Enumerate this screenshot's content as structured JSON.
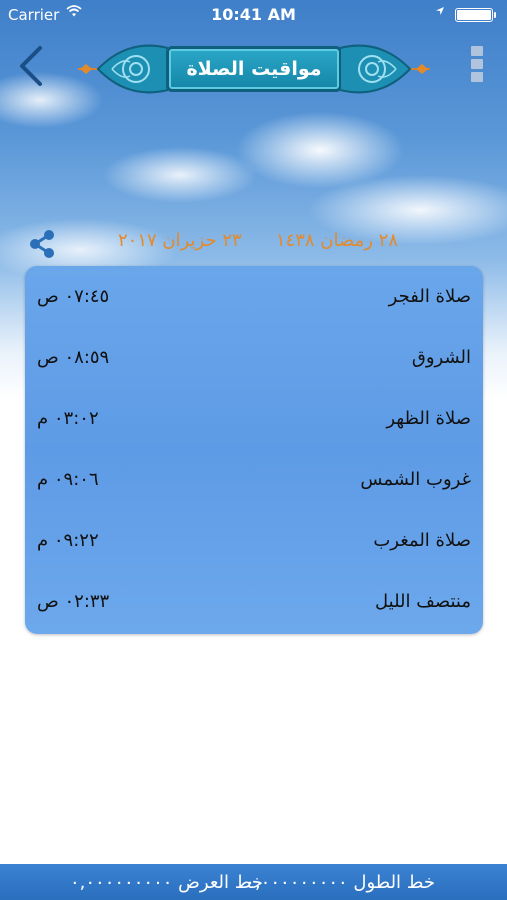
{
  "status_bar": {
    "carrier": "Carrier",
    "time": "10:41 AM",
    "battery_level": 1.0
  },
  "header": {
    "title": "مواقيت الصلاة",
    "back_icon": "chevron-left-icon",
    "menu_icon": "menu-icon"
  },
  "date": {
    "hijri": "٢٨ رمضان ١٤٣٨",
    "gregorian": "٢٣ حزيران ٢٠١٧",
    "color": "#e38a2b"
  },
  "prayers": [
    {
      "name": "صلاة الفجر",
      "time": "٠٧:٤٥ ص"
    },
    {
      "name": "الشروق",
      "time": "٠٨:٥٩ ص"
    },
    {
      "name": "صلاة الظهر",
      "time": "٠٣:٠٢ م"
    },
    {
      "name": "غروب الشمس",
      "time": "٠٩:٠٦ م"
    },
    {
      "name": "صلاة المغرب",
      "time": "٠٩:٢٢ م"
    },
    {
      "name": "منتصف الليل",
      "time": "٠٢:٣٣ ص"
    }
  ],
  "footer": {
    "latitude_text": "خط الطول ٠,٠٠٠٠٠٠٠٠٠",
    "longitude_text": "خط العرض ٠,٠٠٠٠٠٠٠٠٠"
  },
  "colors": {
    "card": "#6aa6ea",
    "banner": "#1486a8",
    "footer": "#2a6fbe"
  }
}
